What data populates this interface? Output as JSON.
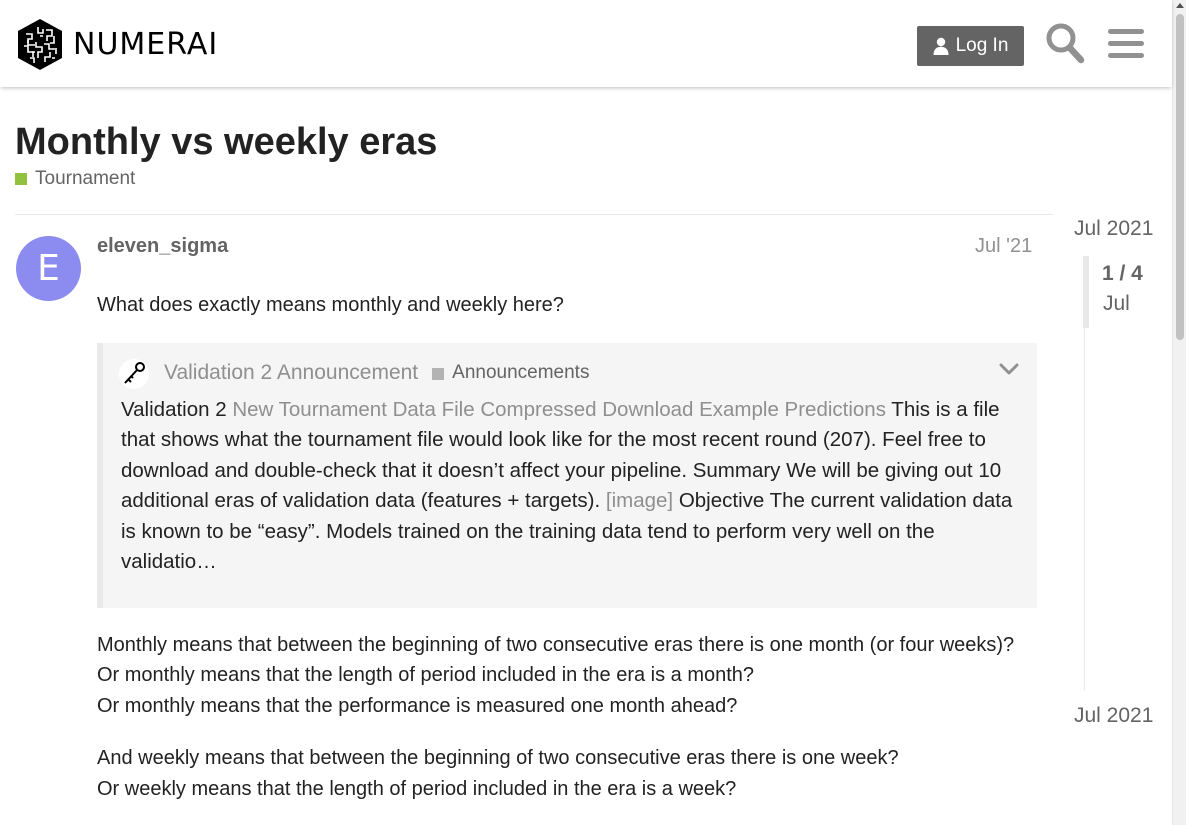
{
  "header": {
    "logo_text": "NUMERAI",
    "login_label": "Log In"
  },
  "topic": {
    "title": "Monthly vs weekly eras",
    "category": "Tournament",
    "category_color": "#92c13f"
  },
  "post": {
    "avatar_letter": "E",
    "avatar_color": "#8c8cf0",
    "username": "eleven_sigma",
    "date": "Jul '21",
    "intro": "What does exactly means monthly and weekly here?",
    "onebox": {
      "title": "Validation 2 Announcement",
      "category": "Announcements",
      "text_start": "Validation 2 ",
      "link_text": "New Tournament Data File Compressed Download Example Predictions",
      "text_middle": " This is a file that shows what the tournament file would look like for the most recent round (207). Feel free to download and double-check that it doesn’t affect your pipeline. Summary We will be giving out 10 additional eras of validation data (features + targets). ",
      "image_text": "[image]",
      "text_end": " Objective The current validation data is known to be “easy”. Models trained on the training data tend to perform very well on the validatio…"
    },
    "monthly_lines": [
      "Monthly means that between the beginning of two consecutive eras there is one month (or four weeks)?",
      "Or monthly means that the length of period included in the era is a month?",
      "Or monthly means that the performance is measured one month ahead?"
    ],
    "weekly_lines": [
      "And weekly means that between the beginning of two consecutive eras there is one week?",
      "Or weekly means that the length of period included in the era is a week?"
    ]
  },
  "timeline": {
    "start_label": "Jul 2021",
    "position": "1 / 4",
    "position_sub": "Jul",
    "end_label": "Jul 2021"
  }
}
